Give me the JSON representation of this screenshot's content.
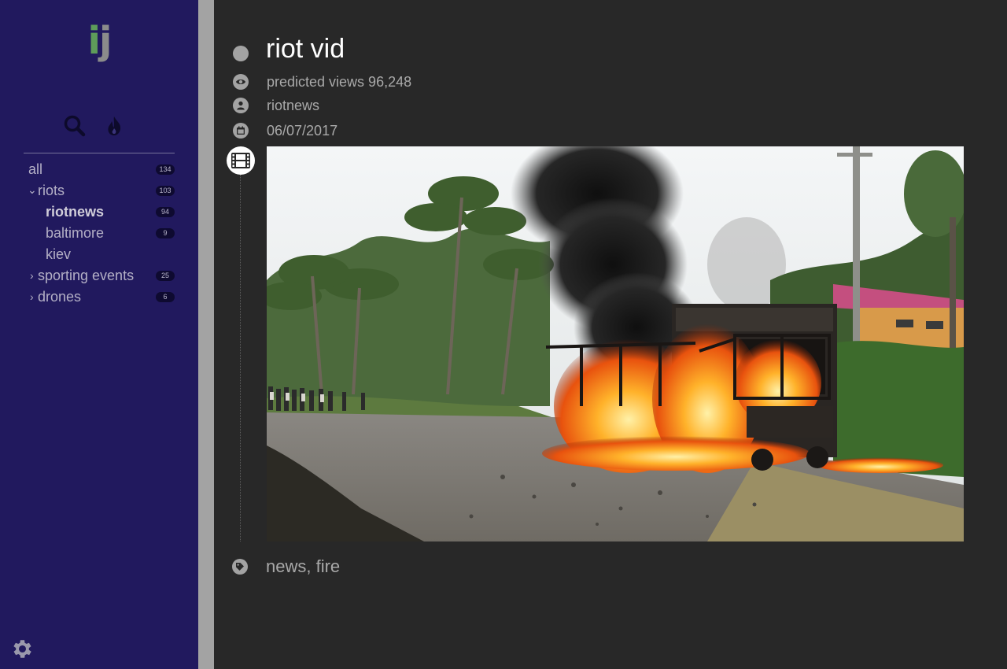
{
  "sidebar": {
    "logo": {
      "letter1": "i",
      "letter2": "j"
    },
    "tools": [
      {
        "name": "search",
        "icon": "search-icon"
      },
      {
        "name": "trending",
        "icon": "flame-icon"
      }
    ],
    "tree": {
      "all": {
        "label": "all",
        "count": "134"
      },
      "riots": {
        "label": "riots",
        "count": "103",
        "expanded": true
      },
      "riotnews": {
        "label": "riotnews",
        "count": "94",
        "active": true
      },
      "baltimore": {
        "label": "baltimore",
        "count": "9"
      },
      "kiev": {
        "label": "kiev"
      },
      "sporting": {
        "label": "sporting events",
        "count": "25",
        "expanded": false
      },
      "drones": {
        "label": "drones",
        "count": "6",
        "expanded": false
      }
    },
    "settings_icon": "gear-icon"
  },
  "item": {
    "title": "riot vid",
    "views": "predicted views 96,248",
    "author": "riotnews",
    "date": "06/07/2017",
    "media_type_icon": "film-icon",
    "tags": "news, fire"
  },
  "colors": {
    "sidebar": "#21195e",
    "background": "#282828",
    "accent_green": "#5e9c5a",
    "icon_grey": "#a3a3a3"
  }
}
